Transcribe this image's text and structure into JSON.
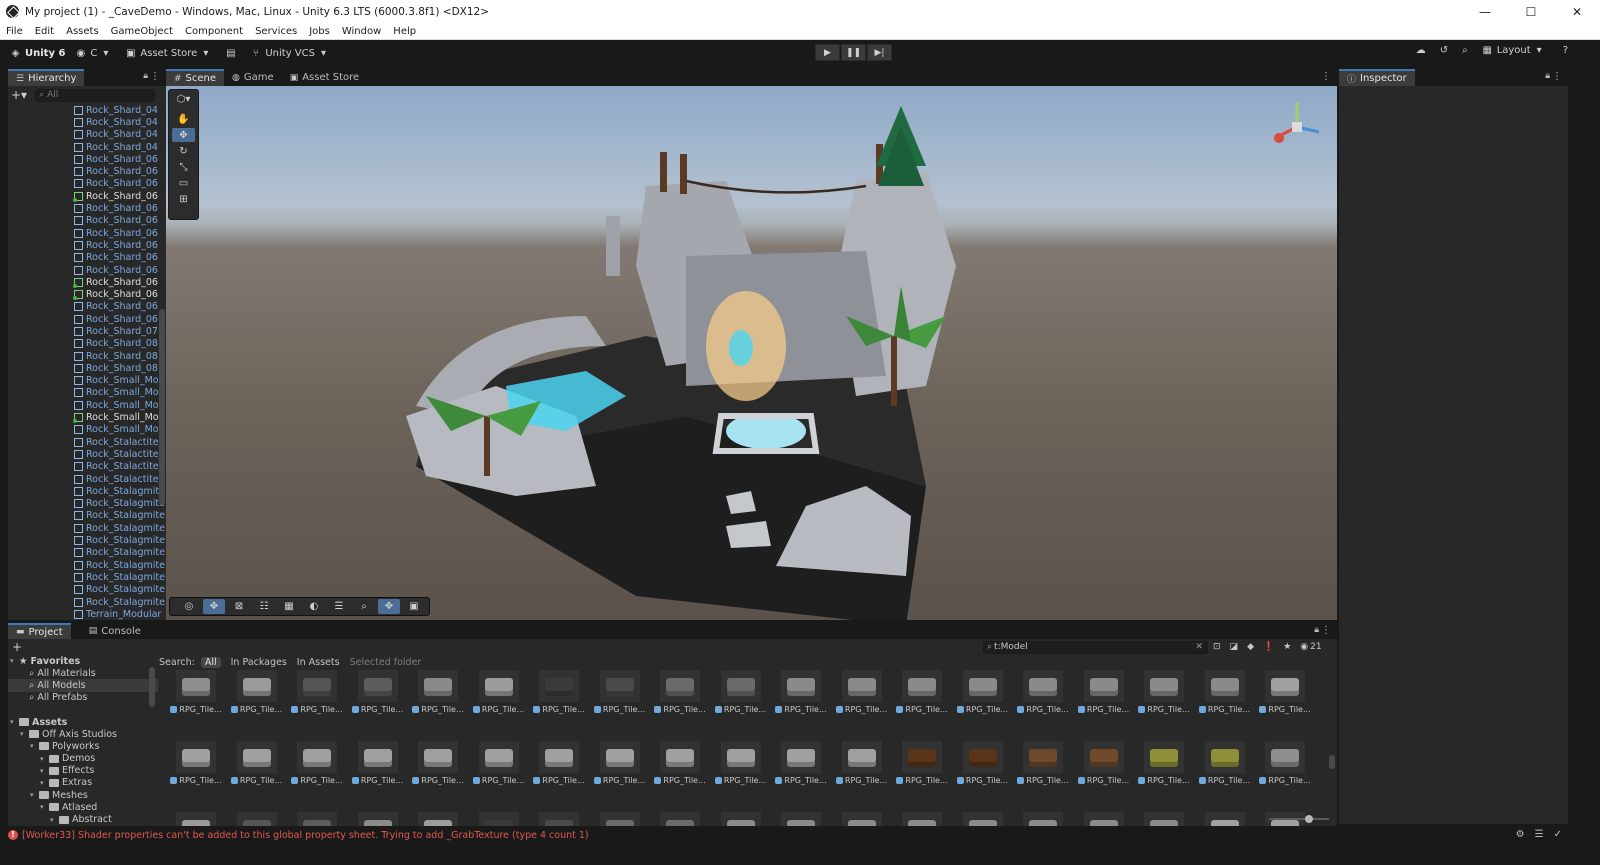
{
  "window": {
    "title": "My project (1) - _CaveDemo - Windows, Mac, Linux - Unity 6.3 LTS (6000.3.8f1) <DX12>",
    "controls": [
      "—",
      "☐",
      "✕"
    ]
  },
  "menu": [
    "File",
    "Edit",
    "Assets",
    "GameObject",
    "Component",
    "Services",
    "Jobs",
    "Window",
    "Help"
  ],
  "toolbar": {
    "brand": "Unity 6",
    "account": "C",
    "asset_store": "Asset Store",
    "vcs": "Unity VCS",
    "layout": "Layout"
  },
  "hierarchy": {
    "tab": "Hierarchy",
    "search_placeholder": "All",
    "items": [
      {
        "label": "Rock_Shard_04",
        "color": "blue"
      },
      {
        "label": "Rock_Shard_04",
        "color": "blue"
      },
      {
        "label": "Rock_Shard_04",
        "color": "blue"
      },
      {
        "label": "Rock_Shard_04",
        "color": "blue"
      },
      {
        "label": "Rock_Shard_06",
        "color": "blue"
      },
      {
        "label": "Rock_Shard_06",
        "color": "blue"
      },
      {
        "label": "Rock_Shard_06",
        "color": "blue"
      },
      {
        "label": "Rock_Shard_06",
        "color": "white"
      },
      {
        "label": "Rock_Shard_06",
        "color": "blue"
      },
      {
        "label": "Rock_Shard_06",
        "color": "blue"
      },
      {
        "label": "Rock_Shard_06",
        "color": "blue"
      },
      {
        "label": "Rock_Shard_06",
        "color": "blue"
      },
      {
        "label": "Rock_Shard_06",
        "color": "blue"
      },
      {
        "label": "Rock_Shard_06",
        "color": "blue"
      },
      {
        "label": "Rock_Shard_06",
        "color": "white"
      },
      {
        "label": "Rock_Shard_06",
        "color": "white"
      },
      {
        "label": "Rock_Shard_06",
        "color": "blue"
      },
      {
        "label": "Rock_Shard_06",
        "color": "blue"
      },
      {
        "label": "Rock_Shard_07",
        "color": "blue"
      },
      {
        "label": "Rock_Shard_08",
        "color": "blue"
      },
      {
        "label": "Rock_Shard_08",
        "color": "blue"
      },
      {
        "label": "Rock_Shard_08",
        "color": "blue"
      },
      {
        "label": "Rock_Small_Mos",
        "color": "blue"
      },
      {
        "label": "Rock_Small_Mos",
        "color": "blue"
      },
      {
        "label": "Rock_Small_Mos",
        "color": "blue"
      },
      {
        "label": "Rock_Small_Mos",
        "color": "white"
      },
      {
        "label": "Rock_Small_Mos",
        "color": "blue"
      },
      {
        "label": "Rock_Stalactite_",
        "color": "blue"
      },
      {
        "label": "Rock_Stalactite_",
        "color": "blue"
      },
      {
        "label": "Rock_Stalactite_",
        "color": "blue"
      },
      {
        "label": "Rock_Stalactite_",
        "color": "blue"
      },
      {
        "label": "Rock_Stalagmite",
        "color": "blue"
      },
      {
        "label": "Rock_Stalagmite",
        "color": "blue"
      },
      {
        "label": "Rock_Stalagmite",
        "color": "blue"
      },
      {
        "label": "Rock_Stalagmite",
        "color": "blue"
      },
      {
        "label": "Rock_Stalagmite",
        "color": "blue"
      },
      {
        "label": "Rock_Stalagmite",
        "color": "blue"
      },
      {
        "label": "Rock_Stalagmite",
        "color": "blue"
      },
      {
        "label": "Rock_Stalagmite",
        "color": "blue"
      },
      {
        "label": "Rock_Stalagmite",
        "color": "blue"
      },
      {
        "label": "Rock_Stalagmite",
        "color": "blue"
      },
      {
        "label": "Terrain_Modular",
        "color": "blue"
      }
    ]
  },
  "scene": {
    "tabs": [
      "Scene",
      "Game",
      "Asset Store"
    ],
    "active_tab": "Scene"
  },
  "inspector": {
    "tab": "Inspector"
  },
  "project": {
    "tabs": [
      "Project",
      "Console"
    ],
    "search_value": "t:Model",
    "count": "21",
    "search_label": "Search:",
    "scopes": [
      "All",
      "In Packages",
      "In Assets",
      "Selected folder"
    ],
    "tree": [
      {
        "label": "Favorites",
        "level": 0,
        "kind": "star"
      },
      {
        "label": "All Materials",
        "level": 1,
        "kind": "search"
      },
      {
        "label": "All Models",
        "level": 1,
        "kind": "search",
        "selected": true
      },
      {
        "label": "All Prefabs",
        "level": 1,
        "kind": "search"
      },
      {
        "label": "",
        "level": 0,
        "kind": "blank"
      },
      {
        "label": "Assets",
        "level": 0,
        "kind": "folder"
      },
      {
        "label": "Off Axis Studios",
        "level": 1,
        "kind": "folder"
      },
      {
        "label": "Polyworks",
        "level": 2,
        "kind": "folder"
      },
      {
        "label": "Demos",
        "level": 3,
        "kind": "folder"
      },
      {
        "label": "Effects",
        "level": 3,
        "kind": "folder"
      },
      {
        "label": "Extras",
        "level": 3,
        "kind": "folder"
      },
      {
        "label": "Meshes",
        "level": 2,
        "kind": "folder"
      },
      {
        "label": "Atlased",
        "level": 3,
        "kind": "folder"
      },
      {
        "label": "Abstract",
        "level": 4,
        "kind": "folder"
      }
    ],
    "asset_label": "RPG_Tile..."
  },
  "status": {
    "message": "[Worker33] Shader properties can't be added to this global property sheet. Trying to add _GrabTexture (type 4 count 1)"
  }
}
